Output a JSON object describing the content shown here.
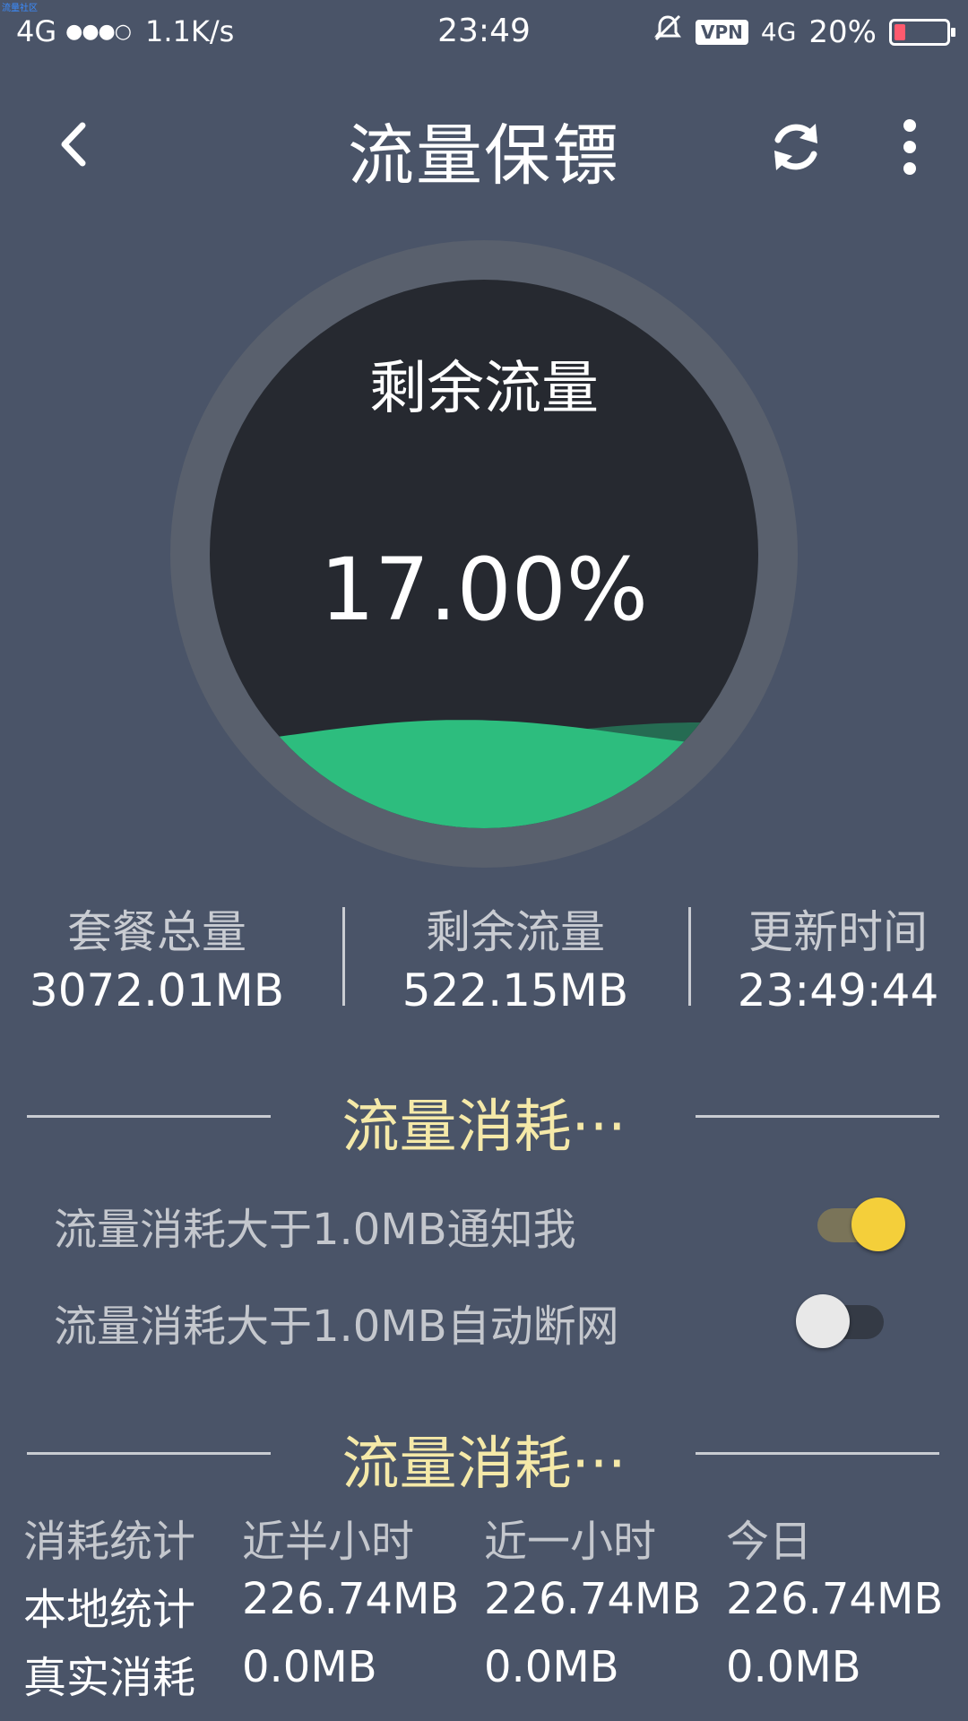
{
  "watermark": "流量社区",
  "status_bar": {
    "network": "4G",
    "signal": "●●●○",
    "speed": "1.1K/s",
    "time": "23:49",
    "vpn": "VPN",
    "network_right": "4G",
    "battery": "20%",
    "battery_level": 0.2
  },
  "app_bar": {
    "title": "流量保镖"
  },
  "gauge": {
    "label": "剩余流量",
    "value": "17.00%",
    "fill_fraction": 0.17,
    "colors": {
      "wave_front": "#2dbd7e",
      "wave_back": "#256b52"
    }
  },
  "stats": {
    "total_label": "套餐总量",
    "total_value": "3072.01MB",
    "remaining_label": "剩余流量",
    "remaining_value": "522.15MB",
    "updated_label": "更新时间",
    "updated_value": "23:49:44"
  },
  "alert_section": {
    "title": "流量消耗···",
    "notify_label": "流量消耗大于1.0MB通知我",
    "notify_on": true,
    "disconnect_label": "流量消耗大于1.0MB自动断网",
    "disconnect_on": false
  },
  "usage_section": {
    "title": "流量消耗···",
    "headers": [
      "消耗统计",
      "近半小时",
      "近一小时",
      "今日"
    ],
    "rows": [
      [
        "本地统计",
        "226.74MB",
        "226.74MB",
        "226.74MB"
      ],
      [
        "真实消耗",
        "0.0MB",
        "0.0MB",
        "0.0MB"
      ]
    ]
  },
  "colors": {
    "background": "#4a5468",
    "accent_yellow": "#f4cf3a",
    "section_title": "#f5e9a8"
  }
}
